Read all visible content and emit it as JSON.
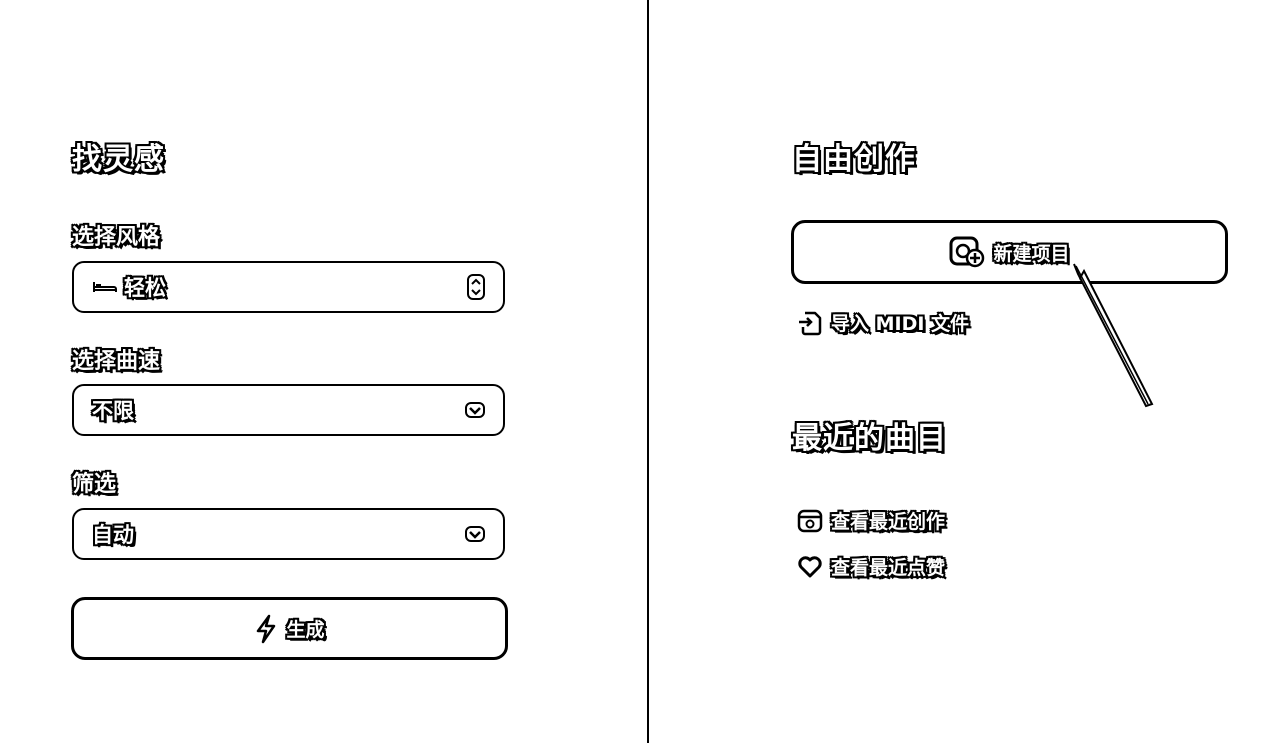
{
  "left": {
    "title": "找灵感",
    "style": {
      "label": "选择风格",
      "value": "轻松",
      "icon": "bed-icon"
    },
    "tempo": {
      "label": "选择曲速",
      "value": "不限"
    },
    "filter": {
      "label": "筛选",
      "value": "自动"
    },
    "generate": {
      "label": "生成",
      "icon": "lightning-icon"
    }
  },
  "right": {
    "title": "自由创作",
    "new_project": {
      "label": "新建项目",
      "icon": "add-file-icon"
    },
    "import_midi": {
      "label": "导入 MIDI 文件",
      "icon": "import-icon"
    },
    "recent_title": "最近的曲目",
    "recent_creations": {
      "label": "查看最近创作",
      "icon": "box-icon"
    },
    "recent_likes": {
      "label": "查看最近点赞",
      "icon": "heart-icon"
    }
  }
}
